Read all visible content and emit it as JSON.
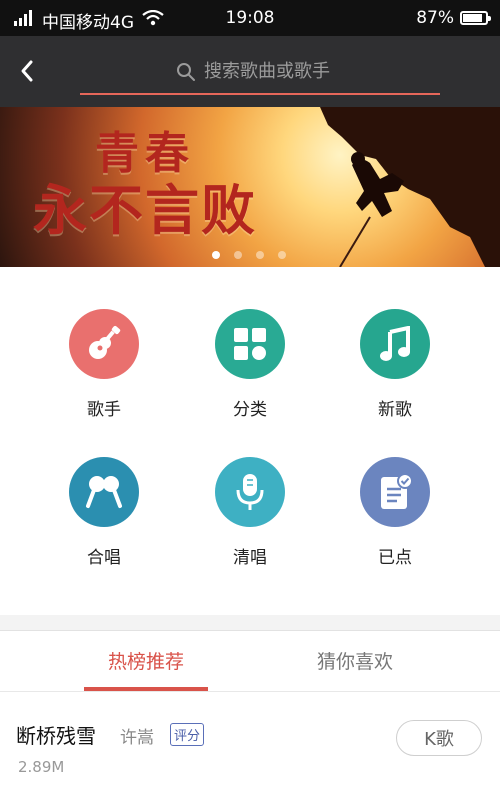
{
  "status_bar": {
    "carrier": "中国移动4G",
    "time": "19:08",
    "battery": "87%",
    "battery_level": 0.87
  },
  "header": {
    "back_icon": "chevron-left-icon",
    "search_placeholder": "搜索歌曲或歌手",
    "accent_color": "#e6675a"
  },
  "banner": {
    "line1": "青春",
    "line2": "永不言败",
    "dots": 4,
    "active_dot": 0
  },
  "grid": {
    "items": [
      {
        "label": "歌手",
        "icon": "guitar-icon",
        "color": "#e9706e"
      },
      {
        "label": "分类",
        "icon": "category-grid-icon",
        "color": "#29aa94"
      },
      {
        "label": "新歌",
        "icon": "music-note-icon",
        "color": "#26a68f"
      },
      {
        "label": "合唱",
        "icon": "duet-microphone-icon",
        "color": "#2b8fb0"
      },
      {
        "label": "清唱",
        "icon": "microphone-icon",
        "color": "#3eb0c3"
      },
      {
        "label": "已点",
        "icon": "selected-list-icon",
        "color": "#6b85bf"
      }
    ]
  },
  "tabs": {
    "active": "热榜推荐",
    "inactive": "猜你喜欢",
    "accent_color": "#d9534a"
  },
  "song": {
    "title": "断桥残雪",
    "artist": "许嵩",
    "tag": "评分",
    "size": "2.89M",
    "button": "K歌"
  }
}
